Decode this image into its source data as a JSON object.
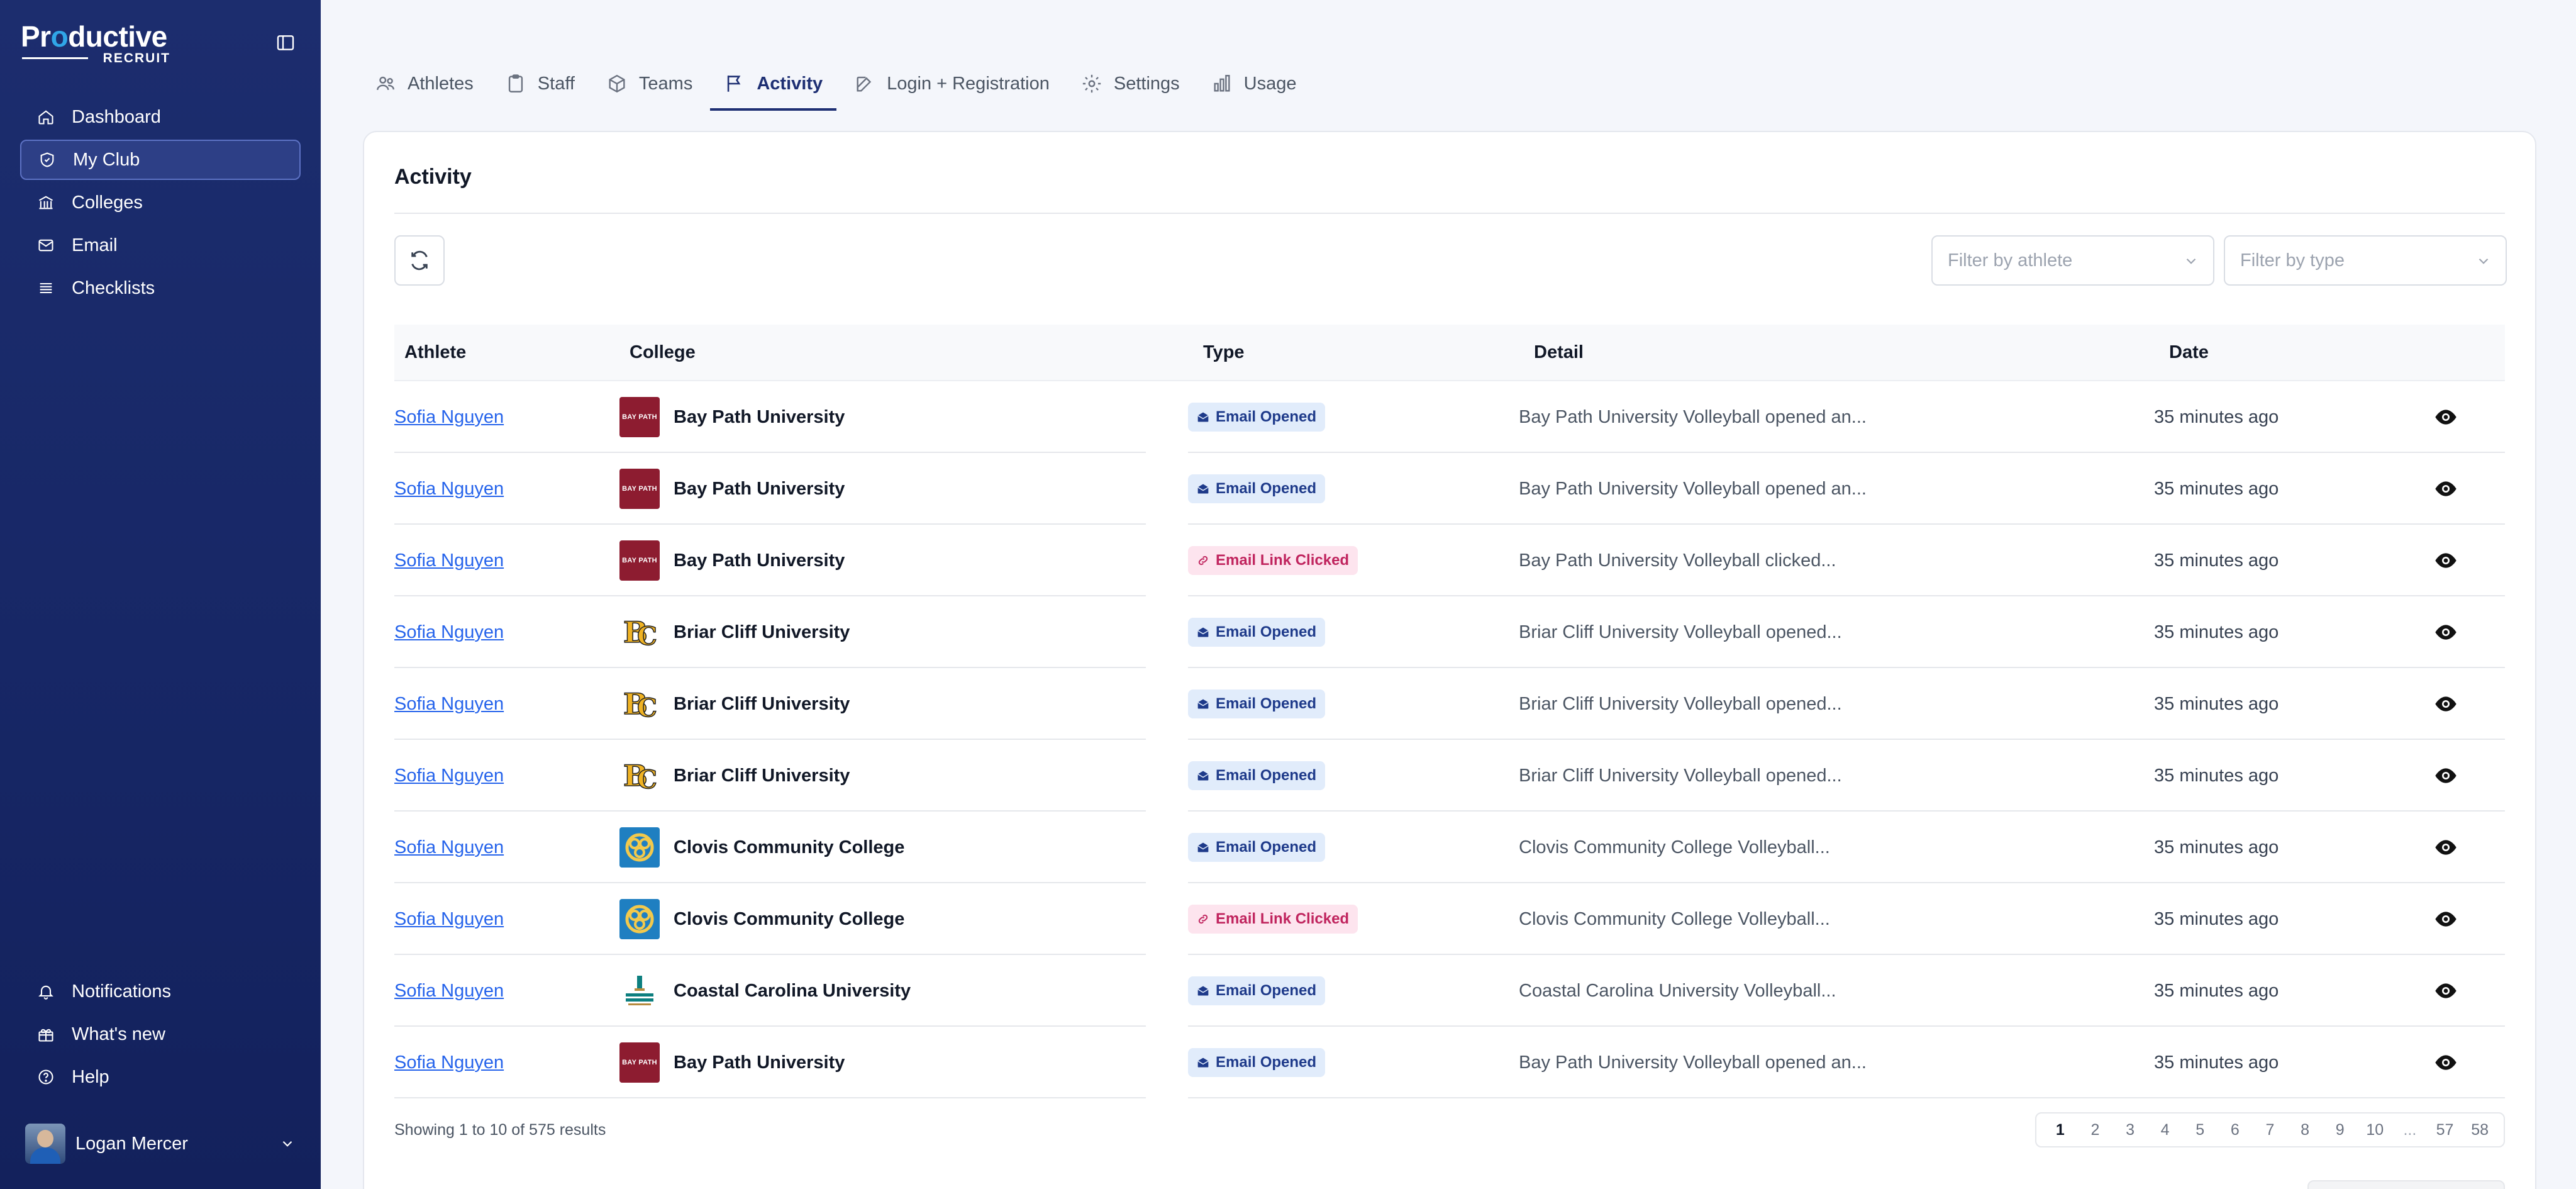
{
  "brand": {
    "word1_pre": "Pr",
    "word1_o": "o",
    "word1_post": "ductive",
    "word2": "RECRUIT"
  },
  "sidebar": {
    "items": [
      {
        "label": "Dashboard",
        "icon": "home-icon"
      },
      {
        "label": "My Club",
        "icon": "shield-icon",
        "active": true
      },
      {
        "label": "Colleges",
        "icon": "building-icon"
      },
      {
        "label": "Email",
        "icon": "mail-icon"
      },
      {
        "label": "Checklists",
        "icon": "list-icon"
      }
    ],
    "bottom": [
      {
        "label": "Notifications",
        "icon": "bell-icon"
      },
      {
        "label": "What's new",
        "icon": "gift-icon"
      },
      {
        "label": "Help",
        "icon": "help-icon"
      }
    ],
    "user": {
      "name": "Logan Mercer"
    }
  },
  "tabs": [
    {
      "label": "Athletes",
      "icon": "users-icon"
    },
    {
      "label": "Staff",
      "icon": "clipboard-icon"
    },
    {
      "label": "Teams",
      "icon": "box-icon"
    },
    {
      "label": "Activity",
      "icon": "flag-icon",
      "active": true
    },
    {
      "label": "Login + Registration",
      "icon": "edit-icon"
    },
    {
      "label": "Settings",
      "icon": "gear-icon"
    },
    {
      "label": "Usage",
      "icon": "bar-chart-icon"
    }
  ],
  "activity": {
    "title": "Activity",
    "filter_athlete_placeholder": "Filter by athlete",
    "filter_type_placeholder": "Filter by type",
    "columns": {
      "athlete": "Athlete",
      "college": "College",
      "type": "Type",
      "detail": "Detail",
      "date": "Date"
    },
    "rows": [
      {
        "athlete": "Sofia Nguyen",
        "college": "Bay Path University",
        "logo": "baypath",
        "type": "Email Opened",
        "kind": "opened",
        "detail": "Bay Path University Volleyball opened an...",
        "date": "35 minutes ago"
      },
      {
        "athlete": "Sofia Nguyen",
        "college": "Bay Path University",
        "logo": "baypath",
        "type": "Email Opened",
        "kind": "opened",
        "detail": "Bay Path University Volleyball opened an...",
        "date": "35 minutes ago"
      },
      {
        "athlete": "Sofia Nguyen",
        "college": "Bay Path University",
        "logo": "baypath",
        "type": "Email Link Clicked",
        "kind": "clicked",
        "detail": "Bay Path University Volleyball clicked...",
        "date": "35 minutes ago"
      },
      {
        "athlete": "Sofia Nguyen",
        "college": "Briar Cliff University",
        "logo": "briar",
        "type": "Email Opened",
        "kind": "opened",
        "detail": "Briar Cliff University Volleyball opened...",
        "date": "35 minutes ago"
      },
      {
        "athlete": "Sofia Nguyen",
        "college": "Briar Cliff University",
        "logo": "briar",
        "type": "Email Opened",
        "kind": "opened",
        "detail": "Briar Cliff University Volleyball opened...",
        "date": "35 minutes ago"
      },
      {
        "athlete": "Sofia Nguyen",
        "college": "Briar Cliff University",
        "logo": "briar",
        "type": "Email Opened",
        "kind": "opened",
        "detail": "Briar Cliff University Volleyball opened...",
        "date": "35 minutes ago"
      },
      {
        "athlete": "Sofia Nguyen",
        "college": "Clovis Community College",
        "logo": "clovis",
        "type": "Email Opened",
        "kind": "opened",
        "detail": "Clovis Community College Volleyball...",
        "date": "35 minutes ago"
      },
      {
        "athlete": "Sofia Nguyen",
        "college": "Clovis Community College",
        "logo": "clovis",
        "type": "Email Link Clicked",
        "kind": "clicked",
        "detail": "Clovis Community College Volleyball...",
        "date": "35 minutes ago"
      },
      {
        "athlete": "Sofia Nguyen",
        "college": "Coastal Carolina University",
        "logo": "coastal",
        "type": "Email Opened",
        "kind": "opened",
        "detail": "Coastal Carolina University Volleyball...",
        "date": "35 minutes ago"
      },
      {
        "athlete": "Sofia Nguyen",
        "college": "Bay Path University",
        "logo": "baypath",
        "type": "Email Opened",
        "kind": "opened",
        "detail": "Bay Path University Volleyball opened an...",
        "date": "35 minutes ago"
      }
    ],
    "summary": "Showing 1 to 10 of 575 results",
    "pages": [
      "1",
      "2",
      "3",
      "4",
      "5",
      "6",
      "7",
      "8",
      "9",
      "10",
      "...",
      "57",
      "58"
    ],
    "current_page": "1"
  },
  "colors": {
    "sidebar": "#1c2d6e",
    "accent": "#1e2f73",
    "link": "#2563eb",
    "opened_badge": "#e1ecfb",
    "clicked_badge": "#fde4ee"
  }
}
